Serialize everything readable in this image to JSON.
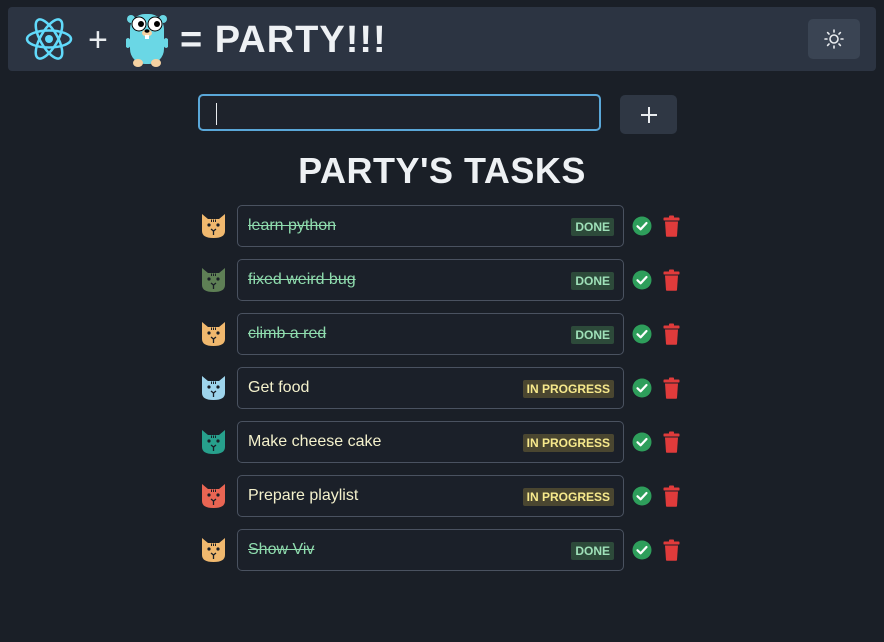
{
  "header": {
    "plus": "+",
    "title": "= PARTY!!!",
    "theme_icon": "sun-icon"
  },
  "input": {
    "value": "",
    "placeholder": ""
  },
  "add_button": {
    "label": "+"
  },
  "tasks_title": "PARTY'S TASKS",
  "colors": {
    "done_text": "#8fdcae",
    "done_badge_bg": "#2d4a3a",
    "progress_badge_bg": "#4a4630",
    "progress_badge_text": "#f7e98c",
    "check": "#2e9e5b",
    "trash": "#e03b3b"
  },
  "tasks": [
    {
      "text": "learn python",
      "status": "DONE",
      "done": true,
      "cat_color": "#f0b86e"
    },
    {
      "text": "fixed weird bug",
      "status": "DONE",
      "done": true,
      "cat_color": "#5e7f55"
    },
    {
      "text": "climb a red",
      "status": "DONE",
      "done": true,
      "cat_color": "#f0b86e"
    },
    {
      "text": "Get food",
      "status": "IN PROGRESS",
      "done": false,
      "cat_color": "#9ed4ec"
    },
    {
      "text": "Make cheese cake",
      "status": "IN PROGRESS",
      "done": false,
      "cat_color": "#27a08c"
    },
    {
      "text": "Prepare playlist",
      "status": "IN PROGRESS",
      "done": false,
      "cat_color": "#e96553"
    },
    {
      "text": "Show Viv",
      "status": "DONE",
      "done": true,
      "cat_color": "#f0b86e"
    }
  ]
}
